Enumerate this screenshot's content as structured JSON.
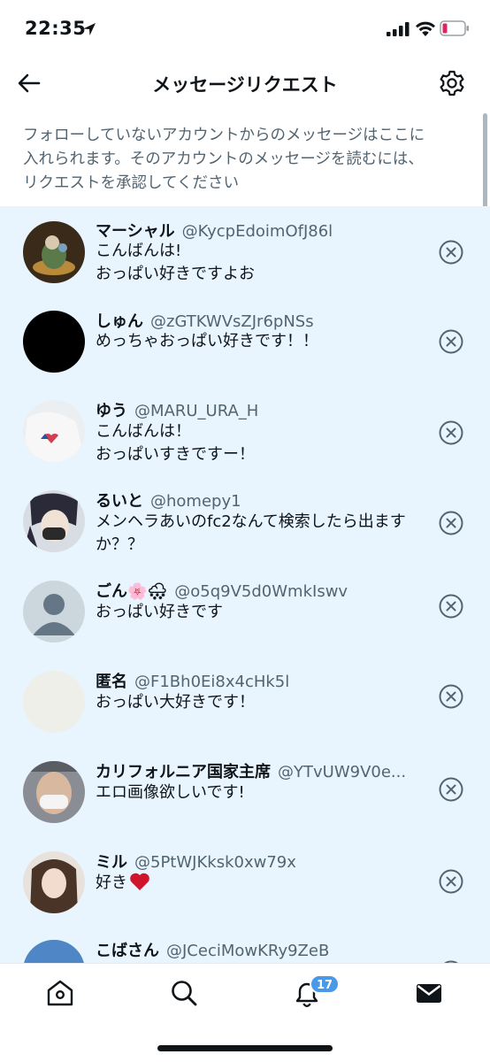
{
  "status_bar": {
    "time": "22:35"
  },
  "header": {
    "title": "メッセージリクエスト"
  },
  "description": {
    "line1": "フォローしていないアカウントからのメッセージはここに",
    "line2": "入れられます。そのアカウントのメッセージを読むには、",
    "line3": "リクエストを承認してください"
  },
  "requests": [
    {
      "name": "マーシャル",
      "handle": "@KycpEdoimOfJ86l",
      "message_line1": "こんばんは!",
      "message_line2": "おっぱい好きですよお"
    },
    {
      "name": "しゅん",
      "handle": "@zGTKWVsZJr6pNSs",
      "message_line1": "めっちゃおっぱい好きです！！",
      "message_line2": ""
    },
    {
      "name": "ゆう",
      "handle": "@MARU_URA_H",
      "message_line1": "こんばんは！",
      "message_line2": "おっぱいすきですー！"
    },
    {
      "name": "るいと",
      "handle": "@homepy1",
      "message_line1": "メンヘラあいのfc2なんて検索したら出ます",
      "message_line2": "か？？"
    },
    {
      "name": "ごん🌸🌨",
      "handle": "@o5q9V5d0WmkIswv",
      "message_line1": "おっぱい好きです",
      "message_line2": ""
    },
    {
      "name": "匿名",
      "handle": "@F1Bh0Ei8x4cHk5l",
      "message_line1": "おっぱい大好きです！",
      "message_line2": ""
    },
    {
      "name": "カリフォルニア国家主席",
      "handle": "@YTvUW9V0e...",
      "message_line1": "エロ画像欲しいです!",
      "message_line2": ""
    },
    {
      "name": "ミル",
      "handle": "@5PtWJKksk0xw79x",
      "message_line1": "好き",
      "message_line2": ""
    },
    {
      "name": "こばさん",
      "handle": "@JCeciMowKRy9ZeB",
      "message_line1": "",
      "message_line2": ""
    }
  ],
  "tabbar": {
    "items": [
      "home-icon",
      "search-icon",
      "notifications-icon",
      "messages-icon"
    ],
    "notifications_badge": "17"
  },
  "colors": {
    "list_background": "#e8f5fe",
    "badge": "#4a99e9",
    "secondary_text": "#536471"
  }
}
